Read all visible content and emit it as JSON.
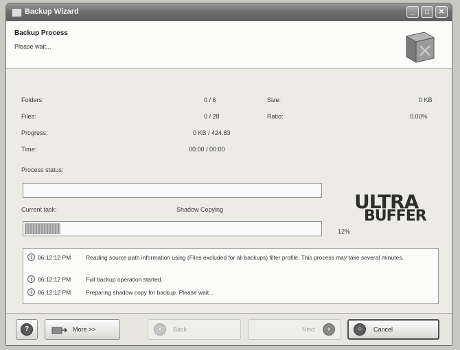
{
  "window": {
    "title": "Backup Wizard"
  },
  "header": {
    "title": "Backup Process",
    "subtitle": "Please wait..."
  },
  "stats": {
    "folders_label": "Folders:",
    "folders_value": "0 / 6",
    "files_label": "Files:",
    "files_value": "0 / 28",
    "progress_label": "Progress:",
    "progress_value": "0 KB / 424.83",
    "time_label": "Time:",
    "time_value": "00:00 / 00:00",
    "size_label": "Size:",
    "size_value": "0 KB",
    "ratio_label": "Ratio:",
    "ratio_value": "0.00%"
  },
  "process_status": {
    "label": "Process status:",
    "progress": 0
  },
  "current_task": {
    "label": "Current task:",
    "value": "Shadow Copying",
    "progress": 0.12,
    "percent_text": "12%"
  },
  "logo": {
    "line1": "ULTRA",
    "line2": "BUFFER"
  },
  "log": [
    {
      "time": "06:12:12 PM",
      "message": "Reading source path information using (Files excluded for all backups) filter profile. This process may take several minutes."
    },
    {
      "time": "06:12:12 PM",
      "message": "Full backup operation started."
    },
    {
      "time": "06:12:12 PM",
      "message": "Preparing shadow copy for backup. Please wait..."
    }
  ],
  "buttons": {
    "help": "?",
    "more": "More >>",
    "back": "Back",
    "next": "Next",
    "cancel": "Cancel"
  },
  "icons": {
    "help": "help-icon",
    "more": "more-options-icon",
    "back": "back-arrow-icon",
    "next": "next-arrow-icon",
    "cancel": "cancel-icon",
    "log": "info-bubble-icon"
  }
}
